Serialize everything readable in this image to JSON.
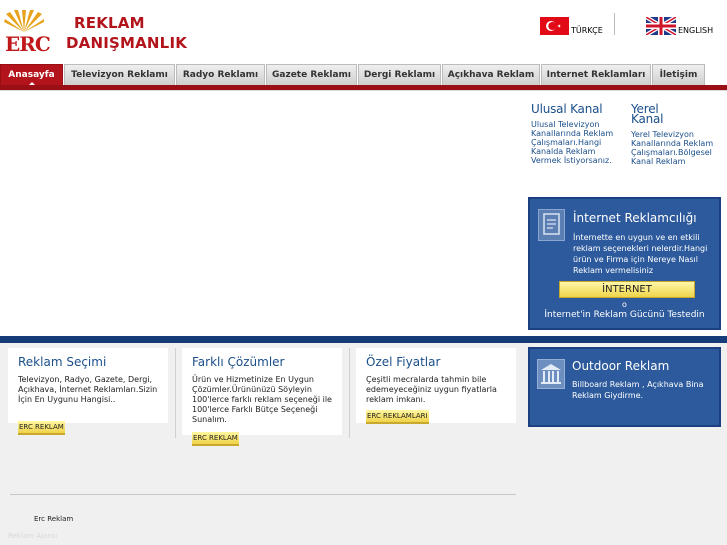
{
  "brand": {
    "logo_mark": "ERC",
    "name_line1": "REKLAM",
    "name_line2": "DANIŞMANLIK"
  },
  "languages": [
    {
      "label": "TÜRKÇE",
      "flag": "turkey-flag-icon"
    },
    {
      "label": "ENGLISH",
      "flag": "uk-flag-icon"
    }
  ],
  "nav": {
    "tabs": [
      {
        "label": "Anasayfa",
        "active": true
      },
      {
        "label": "Televizyon Reklamı"
      },
      {
        "label": "Radyo Reklamı"
      },
      {
        "label": "Gazete Reklamı"
      },
      {
        "label": "Dergi Reklamı"
      },
      {
        "label": "Açıkhava Reklam"
      },
      {
        "label": "Internet Reklamları"
      },
      {
        "label": "İletişim"
      }
    ]
  },
  "kanal": {
    "ulusal": {
      "title": "Ulusal Kanal",
      "text": "Ulusal Televizyon Kanallarında Reklam Çalışmaları.Hangi Kanalda Reklam Vermek İstiyorsanız."
    },
    "yerel": {
      "title": "Yerel Kanal",
      "text": "Yerel Televizyon Kanallarında Reklam Çalışmaları.Bölgesel Kanal Reklam"
    }
  },
  "internet_box": {
    "title": "İnternet Reklamcılığı",
    "text": "İnternette en uygun ve en etkili reklam seçenekleri nelerdir.Hangi ürün ve Firma için Nereye Nasıl Reklam vermelisiniz",
    "button": "İNTERNET",
    "or": "o",
    "test_link": "İnternet'in Reklam Gücünü Testedin"
  },
  "cards": [
    {
      "title": "Reklam Seçimi",
      "text": "Televizyon, Radyo, Gazete, Dergi, Açıkhava, İnternet Reklamları.Sizin İçin En Uygunu Hangisi..",
      "tag": "ERC REKLAM"
    },
    {
      "title": "Farklı Çözümler",
      "text": "Ürün ve Hizmetinize En Uygun Çözümler.Ürününüzü Söyleyin 100'lerce farklı reklam seçeneği ile 100'lerce Farklı Bütçe Seçeneği Sunalım.",
      "tag": "ERC REKLAM"
    },
    {
      "title": "Özel Fiyatlar",
      "text": "Çeşitli mecralarda tahmin bile edemeyeceğiniz uygun fiyatlarla reklam imkanı.",
      "tag": "ERC REKLAMLARI"
    }
  ],
  "outdoor": {
    "title": "Outdoor Reklam",
    "text": "Billboard Reklam , Açıkhava Bina Reklam Giydirme."
  },
  "footer": {
    "link": "Erc Reklam",
    "faint": "Reklam Ajansı"
  },
  "colors": {
    "brand_red": "#b3141b",
    "navy": "#153b78",
    "box_blue": "#2d5a9c",
    "link_blue": "#1b4f8a",
    "tag_yellow": "#f0d54a"
  }
}
